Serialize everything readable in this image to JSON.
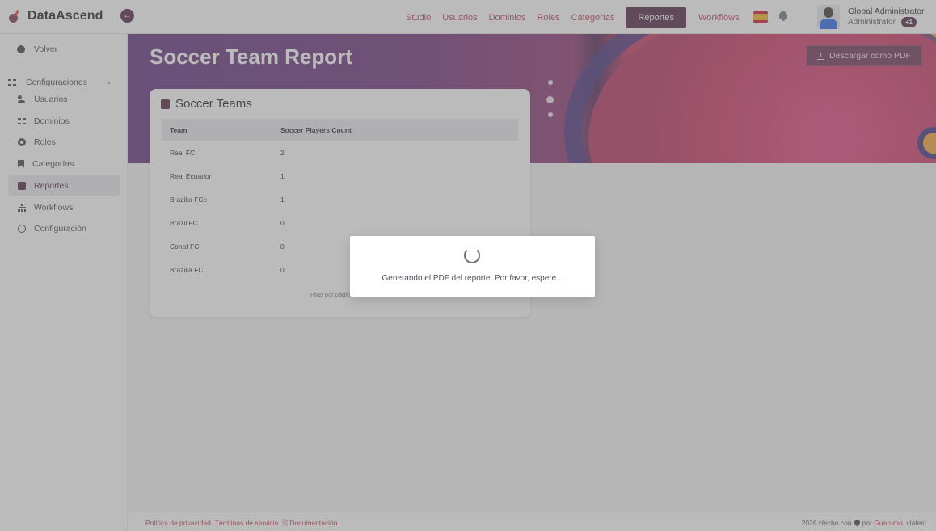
{
  "app": {
    "name": "DataAscend",
    "collapse_icon": "arrow-left-icon"
  },
  "nav": {
    "links": [
      "Studio",
      "Usuarios",
      "Dominios",
      "Roles",
      "Categorías"
    ],
    "active": "Reportes",
    "after": [
      "Workflows"
    ]
  },
  "user": {
    "name": "Global Administrator",
    "role": "Administrator",
    "badge": "+1"
  },
  "sidebar": {
    "back": "Volver",
    "group": "Configuraciones",
    "items": [
      "Usuarios",
      "Dominios",
      "Roles",
      "Categorías",
      "Reportes",
      "Workflows",
      "Configuración"
    ],
    "active_index": 4
  },
  "page": {
    "title": "Soccer Team Report",
    "download_button": "Descargar como PDF"
  },
  "card": {
    "title": "Soccer Teams",
    "columns": [
      "Team",
      "Soccer Players Count"
    ],
    "rows": [
      [
        "Real FC",
        "2"
      ],
      [
        "Real Ecuador",
        "1"
      ],
      [
        "Brazilia FCc",
        "1"
      ],
      [
        "Brazil FC",
        "0"
      ],
      [
        "Conaf FC",
        "0"
      ],
      [
        "Brazilia FC",
        "0"
      ]
    ],
    "pager_label": "Filas por página"
  },
  "footer": {
    "privacy": "Política de privacidad",
    "terms": "Términos de servicio",
    "docs": "Documentación",
    "made_prefix": "2026 Hecho con",
    "made_by": "por",
    "brand": "Guarumo",
    "version": ".vlatest"
  },
  "modal": {
    "message": "Generando el PDF del reporte. Por favor, espere..."
  },
  "colors": {
    "accent": "#4a1f3e",
    "link": "#b8304a"
  }
}
